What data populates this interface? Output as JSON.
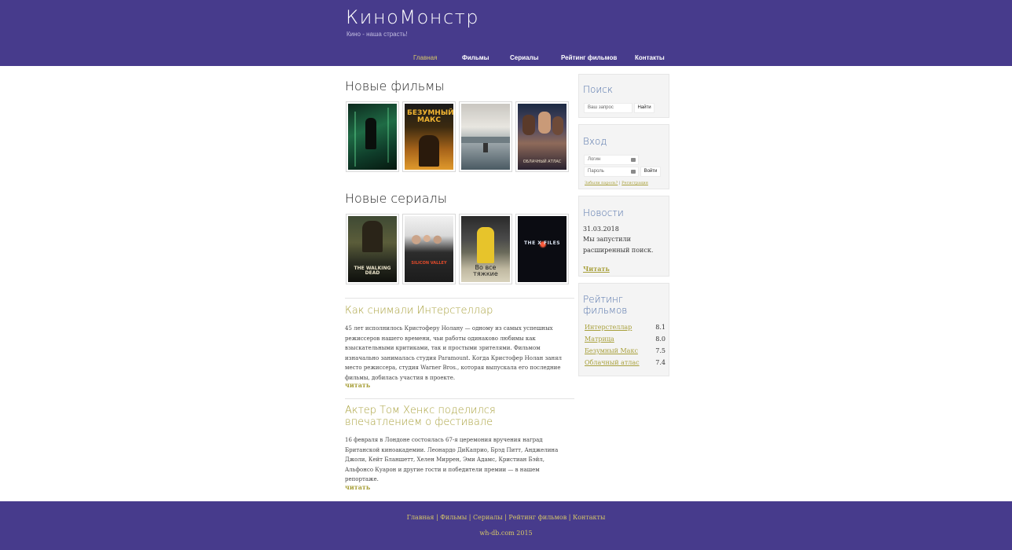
{
  "site": {
    "logo": "КиноМонстр",
    "slogan": "Кино - наша страсть!"
  },
  "nav": [
    {
      "label": "Главная",
      "active": true
    },
    {
      "label": "Фильмы",
      "active": false
    },
    {
      "label": "Сериалы",
      "active": false
    },
    {
      "label": "Рейтинг фильмов",
      "active": false
    },
    {
      "label": "Контакты",
      "active": false
    }
  ],
  "new_movies": {
    "title": "Новые фильмы",
    "posters": [
      {
        "name": "matrix",
        "text": ""
      },
      {
        "name": "mad-max",
        "text": "БЕЗУМНЫЙ МАКС"
      },
      {
        "name": "interstellar",
        "text": ""
      },
      {
        "name": "cloud-atlas",
        "text": "ОБЛАЧНЫЙ АТЛАС"
      }
    ]
  },
  "new_series": {
    "title": "Новые сериалы",
    "posters": [
      {
        "name": "walking-dead",
        "text": "THE WALKING DEAD"
      },
      {
        "name": "silicon-valley",
        "text": "SILICON VALLEY"
      },
      {
        "name": "breaking-bad",
        "text": "Во все тяжкие"
      },
      {
        "name": "x-files",
        "text": "THE X FILES"
      }
    ]
  },
  "articles": [
    {
      "title": "Как снимали Интерстеллар",
      "text": "45 лет исполнилось Кристоферу Нолану — одному из самых успешных режиссеров нашего времени, чьи работы одинаково любимы как взыскательными критиками, так и простыми зрителями. Фильмом изначально занималась студия Paramount. Когда Кристофер Нолан занял место режиссера, студия Warner Bros., которая выпускала его последние фильмы, добилась участия в проекте.",
      "read": "читать"
    },
    {
      "title": "Актер Том Хенкс поделился впечатлением о фестивале",
      "text": "16 февраля в Лондоне состоялась 67-я церемония вручения наград Британской киноакадемии. Леонардо ДиКаприо, Брэд Питт, Анджелина Джоли, Кейт Бланшетт, Хелен Миррен, Эми Адамс, Кристиан Бэйл, Альфонсо Куарон и другие гости и победители премии — в нашем репортаже.",
      "read": "читать"
    }
  ],
  "search": {
    "title": "Поиск",
    "placeholder": "Ваш запрос",
    "button": "Найти"
  },
  "login": {
    "title": "Вход",
    "login_placeholder": "Логин",
    "password_placeholder": "Пароль",
    "button": "Войти",
    "forgot": "Забыли пароль?",
    "divider": " | ",
    "register": "Регистрация"
  },
  "news": {
    "title": "Новости",
    "date": "31.03.2018",
    "text": "Мы запустили расширенный поиск.",
    "read": "Читать"
  },
  "rating": {
    "title": "Рейтинг фильмов",
    "items": [
      {
        "name": "Интерстеллар",
        "score": "8.1"
      },
      {
        "name": "Матрица",
        "score": "8.0"
      },
      {
        "name": "Безумный Макс",
        "score": "7.5"
      },
      {
        "name": "Облачный атлас",
        "score": "7.4"
      }
    ]
  },
  "footer": {
    "links": [
      "Главная",
      "Фильмы",
      "Сериалы",
      "Рейтинг фильмов",
      "Контакты"
    ],
    "separator": " | ",
    "copyright": "wh-db.com 2015"
  },
  "colors": {
    "header_bg": "#473b8c",
    "accent_gold": "#a8a03b",
    "sidebar_title": "#4f6fa8"
  }
}
